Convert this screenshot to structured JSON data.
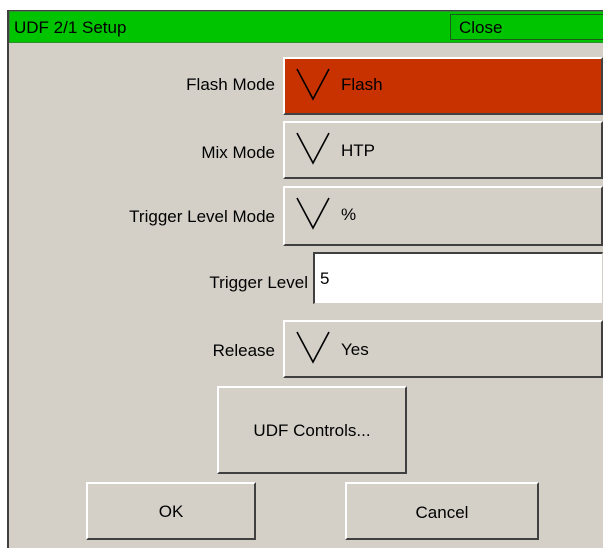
{
  "dialog": {
    "title": "UDF 2/1 Setup",
    "close_label": "Close",
    "titlebar_color": "#00c400"
  },
  "fields": {
    "flash_mode": {
      "label": "Flash Mode",
      "value": "Flash",
      "color": "#c83200"
    },
    "mix_mode": {
      "label": "Mix Mode",
      "value": "HTP"
    },
    "trigger_level_mode": {
      "label": "Trigger Level Mode",
      "value": "%"
    },
    "trigger_level": {
      "label": "Trigger Level",
      "value": "5"
    },
    "release": {
      "label": "Release",
      "value": "Yes"
    }
  },
  "buttons": {
    "udf_controls": "UDF Controls...",
    "ok": "OK",
    "cancel": "Cancel"
  },
  "icons": {
    "dropdown": "chevron-down-icon"
  }
}
